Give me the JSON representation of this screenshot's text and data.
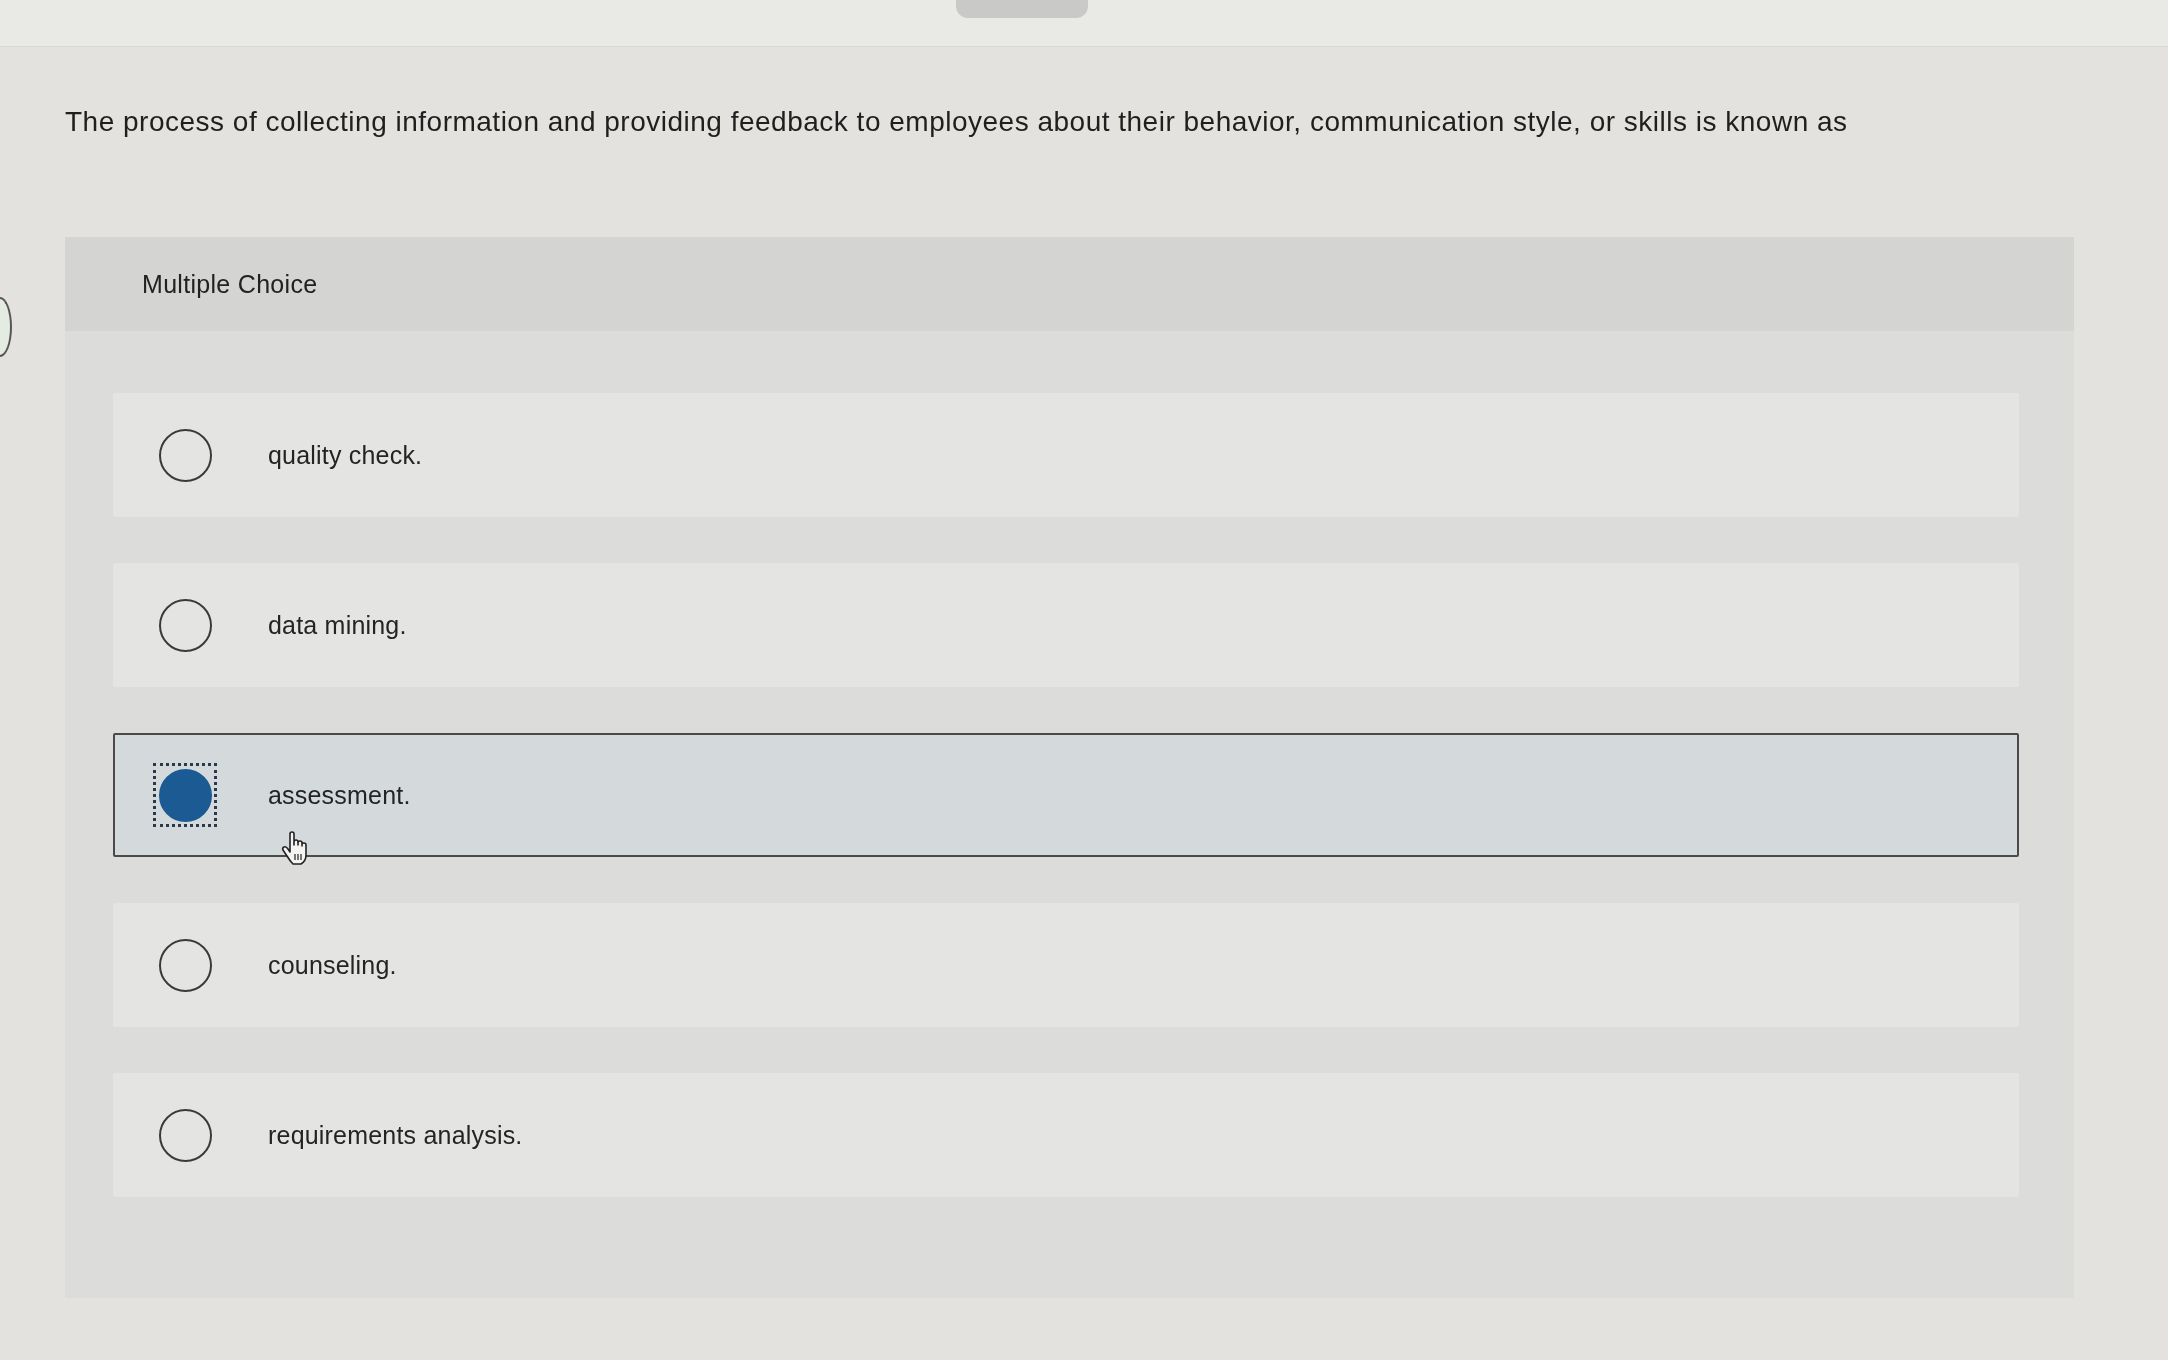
{
  "question": {
    "text": "The process of collecting information and providing feedback to employees about their behavior, communication style, or skills is known as"
  },
  "answer_panel": {
    "heading": "Multiple Choice",
    "options": [
      {
        "label": "quality check.",
        "selected": false
      },
      {
        "label": "data mining.",
        "selected": false
      },
      {
        "label": "assessment.",
        "selected": true
      },
      {
        "label": "counseling.",
        "selected": false
      },
      {
        "label": "requirements analysis.",
        "selected": false
      }
    ]
  }
}
